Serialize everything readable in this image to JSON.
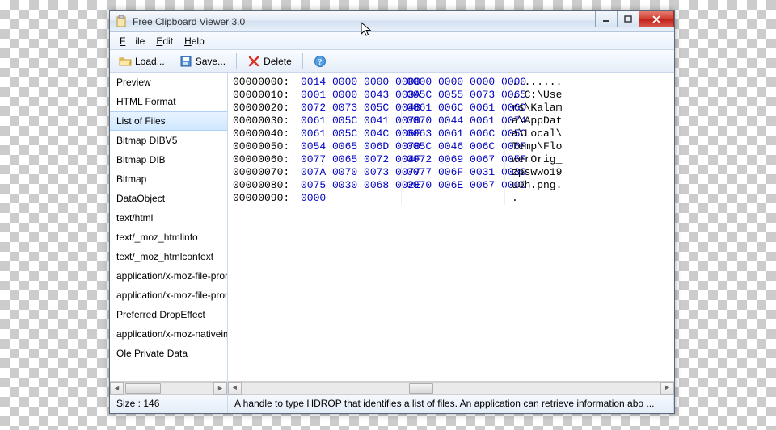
{
  "window": {
    "title": "Free Clipboard Viewer 3.0"
  },
  "menubar": {
    "file": "File",
    "edit": "Edit",
    "help": "Help"
  },
  "toolbar": {
    "load": "Load...",
    "save": "Save...",
    "delete": "Delete"
  },
  "sidebar": {
    "items": [
      "Preview",
      "HTML Format",
      "List of Files",
      "Bitmap DIBV5",
      "Bitmap DIB",
      "Bitmap",
      "DataObject",
      "text/html",
      "text/_moz_htmlinfo",
      "text/_moz_htmlcontext",
      "application/x-moz-file-promise",
      "application/x-moz-file-promise",
      "Preferred DropEffect",
      "application/x-moz-nativeimage",
      "Ole Private Data"
    ],
    "selected_index": 2
  },
  "hex": {
    "rows": [
      {
        "off": "00000000:",
        "g1": "0014 0000 0000 0000",
        "g2": "0000 0000 0000 0000",
        "a": "........"
      },
      {
        "off": "00000010:",
        "g1": "0001 0000 0043 003A",
        "g2": "005C 0055 0073 0065",
        "a": "..C:\\Use"
      },
      {
        "off": "00000020:",
        "g1": "0072 0073 005C 004B",
        "g2": "0061 006C 0061 006D",
        "a": "rs\\Kalam"
      },
      {
        "off": "00000030:",
        "g1": "0061 005C 0041 0070",
        "g2": "0070 0044 0061 0074",
        "a": "a\\AppDat"
      },
      {
        "off": "00000040:",
        "g1": "0061 005C 004C 006F",
        "g2": "0063 0061 006C 005C",
        "a": "a\\Local\\"
      },
      {
        "off": "00000050:",
        "g1": "0054 0065 006D 0070",
        "g2": "005C 0046 006C 006F",
        "a": "Temp\\Flo"
      },
      {
        "off": "00000060:",
        "g1": "0077 0065 0072 004F",
        "g2": "0072 0069 0067 005F",
        "a": "werOrig_"
      },
      {
        "off": "00000070:",
        "g1": "007A 0070 0073 0077",
        "g2": "0077 006F 0031 0039",
        "a": "zpswwo19"
      },
      {
        "off": "00000080:",
        "g1": "0075 0030 0068 002E",
        "g2": "0070 006E 0067 0000",
        "a": "u0h.png."
      },
      {
        "off": "00000090:",
        "g1": "0000",
        "g2": "",
        "a": "."
      }
    ]
  },
  "statusbar": {
    "size_label": "Size : 146",
    "description": "A handle to type HDROP that identifies a list of files. An application can retrieve information abo ..."
  }
}
